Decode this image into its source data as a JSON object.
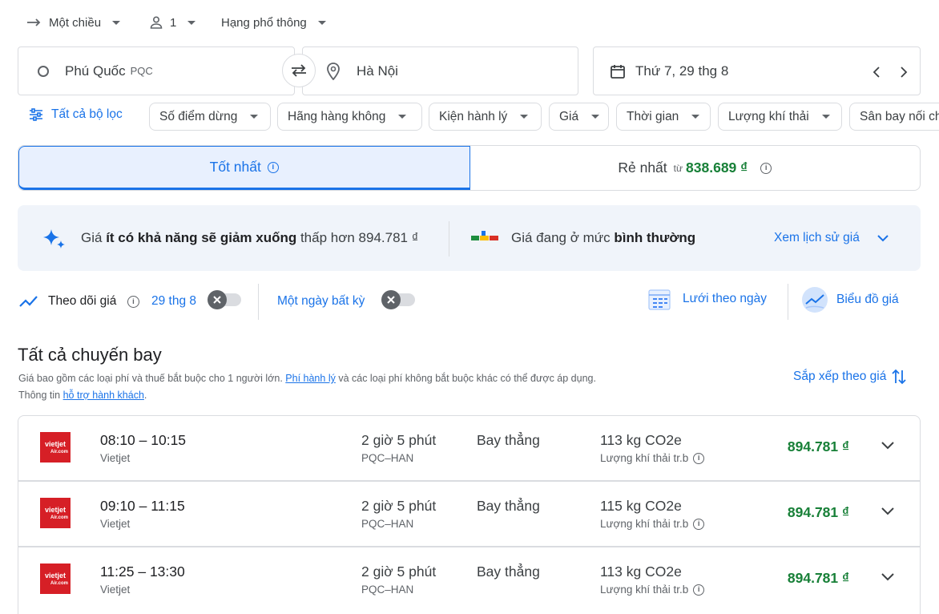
{
  "top": {
    "trip_type": "Một chiều",
    "passengers": "1",
    "cabin_class": "Hạng phổ thông"
  },
  "search": {
    "origin": "Phú Quốc",
    "origin_code": "PQC",
    "destination": "Hà Nội",
    "date": "Thứ 7, 29 thg 8"
  },
  "filters": {
    "all_filters": "Tất cả bộ lọc",
    "chips": [
      "Số điểm dừng",
      "Hãng hàng không",
      "Kiện hành lý",
      "Giá",
      "Thời gian",
      "Lượng khí thải",
      "Sân bay nối chuyến"
    ]
  },
  "tabs": {
    "best": "Tốt nhất",
    "cheapest": "Rẻ nhất",
    "cheapest_from": "từ",
    "cheapest_price": "838.689 ₫"
  },
  "insight": {
    "prefix": "Giá ",
    "bold": "ít có khả năng sẽ giảm xuống",
    "suffix": " thấp hơn 894.781 ₫",
    "level_prefix": "Giá đang ở mức ",
    "level_bold": "bình thường",
    "history_link": "Xem lịch sử giá"
  },
  "tracking": {
    "label": "Theo dõi giá",
    "date": "29 thg 8",
    "any_date": "Một ngày bất kỳ",
    "date_grid": "Lưới theo ngày",
    "price_graph": "Biểu đồ giá"
  },
  "results": {
    "title": "Tất cả chuyến bay",
    "note_1": "Giá bao gồm các loại phí và thuế bắt buộc cho 1 người lớn. ",
    "note_link_1": "Phí hành lý",
    "note_2": " và các loại phí không bắt buộc khác có thể được áp dụng.",
    "note_3": "Thông tin ",
    "note_link_2": "hỗ trợ hành khách",
    "note_4": ".",
    "sort": "Sắp xếp theo giá"
  },
  "flights": [
    {
      "time": "08:10 – 10:15",
      "airline": "Vietjet",
      "duration": "2 giờ 5 phút",
      "route": "PQC–HAN",
      "stops": "Bay thẳng",
      "co2": "113 kg CO2e",
      "emissions": "Lượng khí thải tr.b",
      "price": "894.781 ₫"
    },
    {
      "time": "09:10 – 11:15",
      "airline": "Vietjet",
      "duration": "2 giờ 5 phút",
      "route": "PQC–HAN",
      "stops": "Bay thẳng",
      "co2": "115 kg CO2e",
      "emissions": "Lượng khí thải tr.b",
      "price": "894.781 ₫"
    },
    {
      "time": "11:25 – 13:30",
      "airline": "Vietjet",
      "duration": "2 giờ 5 phút",
      "route": "PQC–HAN",
      "stops": "Bay thẳng",
      "co2": "113 kg CO2e",
      "emissions": "Lượng khí thải tr.b",
      "price": "894.781 ₫"
    }
  ],
  "logo_text": {
    "line1": "vietjet",
    "line2": "Air.com"
  },
  "colors": {
    "accent": "#1a73e8",
    "price_green": "#188038",
    "logo_red": "#d61f26",
    "banner_bg": "#f0f4fa"
  }
}
